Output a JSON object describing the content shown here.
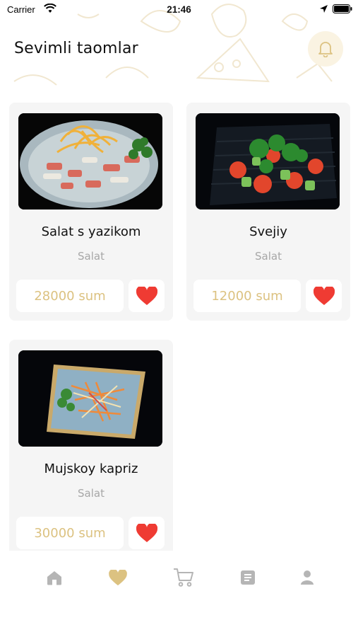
{
  "status_bar": {
    "carrier": "Carrier",
    "time": "21:46",
    "icons": [
      "wifi-icon",
      "location-arrow-icon",
      "battery-icon"
    ]
  },
  "header": {
    "title": "Sevimli taomlar",
    "bell_icon": "bell-icon"
  },
  "colors": {
    "accent": "#dcc281",
    "heart": "#ef3b33",
    "card_bg": "#f5f5f5",
    "muted_text": "#a7a7a7",
    "tab_inactive": "#b5b5b5"
  },
  "favorites": [
    {
      "name": "Salat s yazikom",
      "category": "Salat",
      "price": "28000 sum",
      "image": "salad-tongue-photo"
    },
    {
      "name": "Svejiy",
      "category": "Salat",
      "price": "12000 sum",
      "image": "fresh-salad-photo"
    },
    {
      "name": "Mujskoy kapriz",
      "category": "Salat",
      "price": "30000 sum",
      "image": "mens-caprice-salad-photo"
    }
  ],
  "tabbar": {
    "items": [
      {
        "icon": "home-icon",
        "active": false
      },
      {
        "icon": "heart-icon",
        "active": true
      },
      {
        "icon": "cart-icon",
        "active": false
      },
      {
        "icon": "orders-icon",
        "active": false
      },
      {
        "icon": "profile-icon",
        "active": false
      }
    ]
  }
}
